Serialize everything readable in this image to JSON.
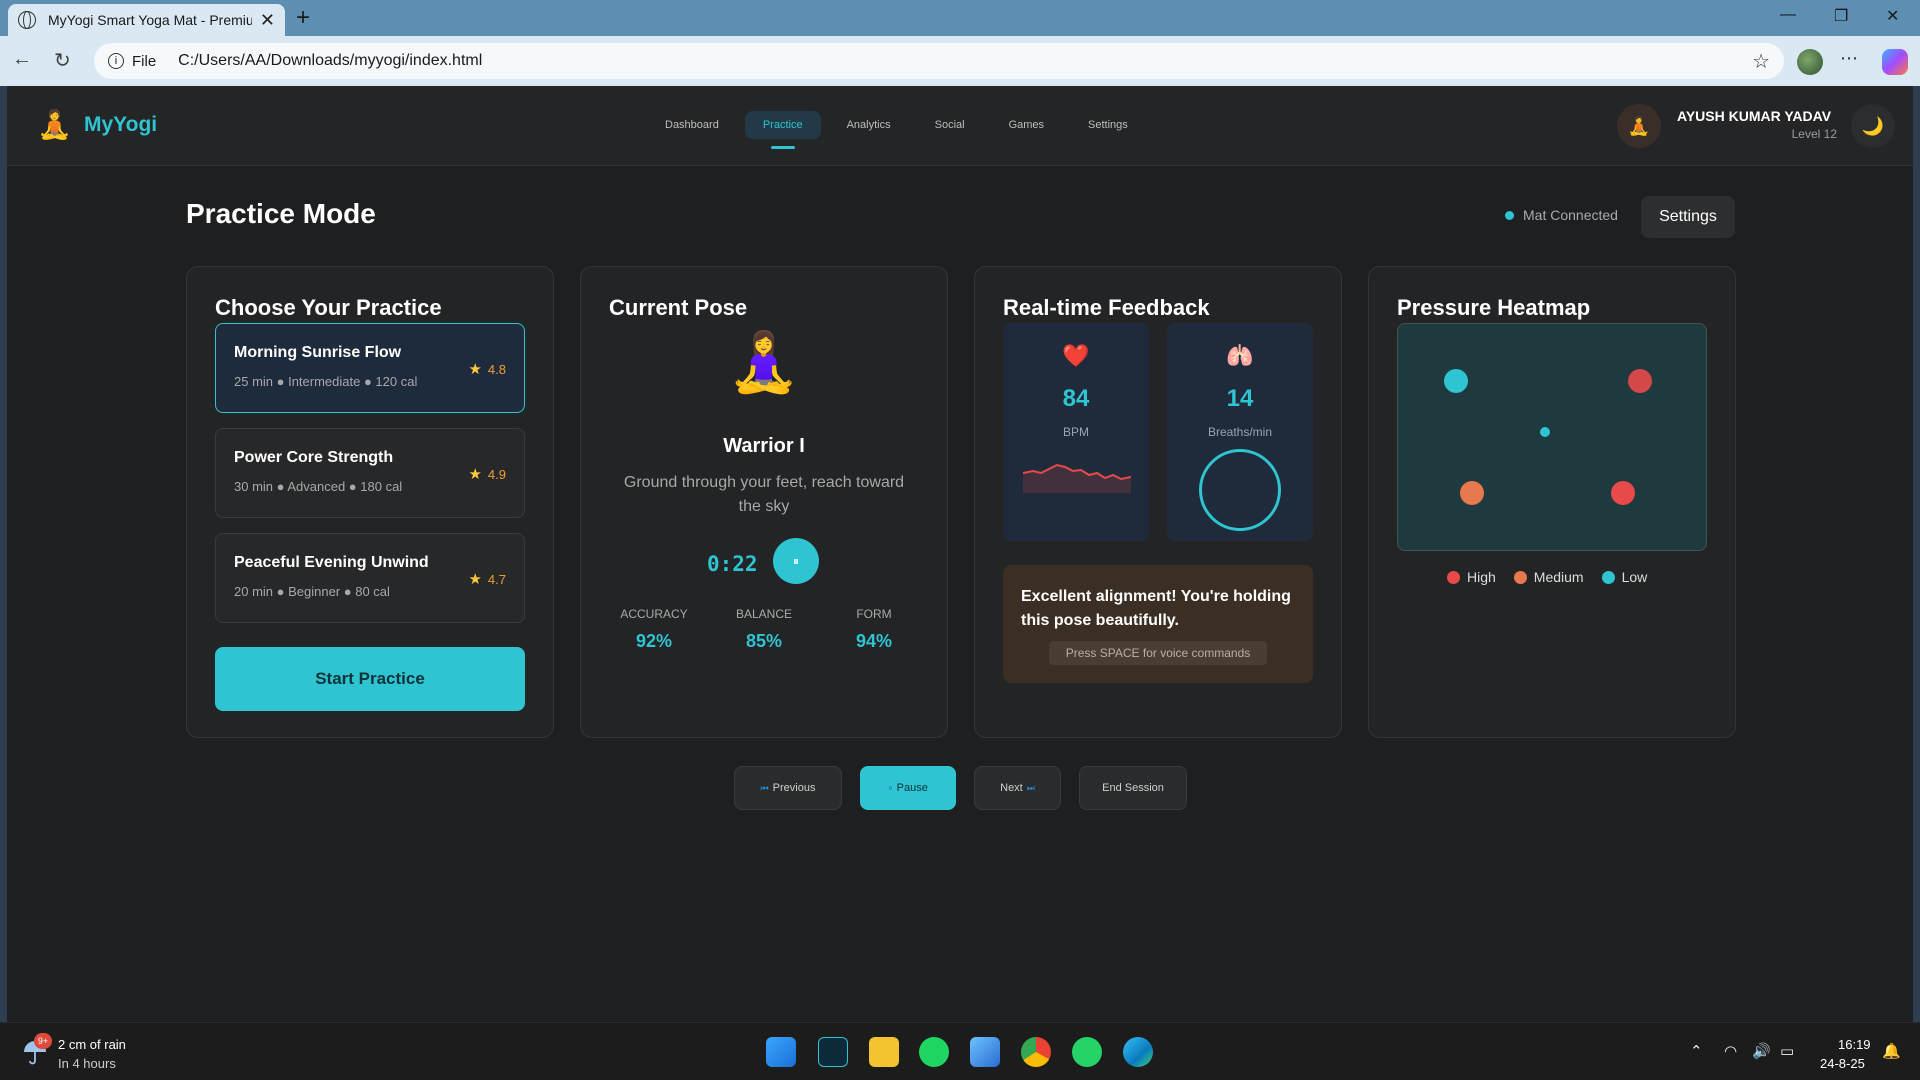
{
  "browser": {
    "tab_title": "MyYogi Smart Yoga Mat - Premiu",
    "new_tab": "+",
    "url_scheme_label": "File",
    "url": "C:/Users/AA/Downloads/myyogi/index.html"
  },
  "app": {
    "logo_icon": "🧘",
    "brand": "MyYogi",
    "nav": [
      {
        "label": "Dashboard"
      },
      {
        "label": "Practice"
      },
      {
        "label": "Analytics"
      },
      {
        "label": "Social"
      },
      {
        "label": "Games"
      },
      {
        "label": "Settings"
      }
    ],
    "active_nav": "Practice",
    "user": {
      "avatar": "🧘",
      "name": "AYUSH KUMAR YADAV",
      "level": "Level 12"
    },
    "theme_icon": "🌙"
  },
  "page": {
    "title": "Practice Mode",
    "mat_status": "Mat Connected",
    "settings_label": "Settings"
  },
  "choose_practice": {
    "title": "Choose Your Practice",
    "items": [
      {
        "name": "Morning Sunrise Flow",
        "meta": "25 min ● Intermediate ● 120 cal",
        "rating": "4.8",
        "selected": true
      },
      {
        "name": "Power Core Strength",
        "meta": "30 min ● Advanced ● 180 cal",
        "rating": "4.9",
        "selected": false
      },
      {
        "name": "Peaceful Evening Unwind",
        "meta": "20 min ● Beginner ● 80 cal",
        "rating": "4.7",
        "selected": false
      }
    ],
    "start_label": "Start Practice"
  },
  "current_pose": {
    "title": "Current Pose",
    "emoji": "🧘‍♀️",
    "name": "Warrior I",
    "description": "Ground through your feet, reach toward the sky",
    "timer": "0:22",
    "timer_button_icon": "⏸",
    "metrics": [
      {
        "label": "ACCURACY",
        "value": "92%"
      },
      {
        "label": "BALANCE",
        "value": "85%"
      },
      {
        "label": "FORM",
        "value": "94%"
      }
    ]
  },
  "feedback": {
    "title": "Real-time Feedback",
    "heart": {
      "icon": "❤️",
      "value": "84",
      "unit": "BPM"
    },
    "breath": {
      "icon": "🫁",
      "value": "14",
      "unit": "Breaths/min"
    },
    "message": "Excellent alignment! You're holding this pose beautifully.",
    "hint": "Press SPACE for voice commands"
  },
  "heatmap": {
    "title": "Pressure Heatmap",
    "legend": [
      {
        "label": "High",
        "color": "#e84a4a"
      },
      {
        "label": "Medium",
        "color": "#e8784e"
      },
      {
        "label": "Low",
        "color": "#2ec4d1"
      }
    ]
  },
  "controls": {
    "previous": "Previous",
    "pause": "Pause",
    "next": "Next",
    "end": "End Session",
    "previous_icon": "⏮",
    "pause_icon": "⏸",
    "next_icon": "⏭"
  },
  "taskbar": {
    "weather_badge": "9+",
    "weather_line1": "2 cm of rain",
    "weather_line2": "In 4 hours",
    "time": "16:19",
    "date": "24-8-25"
  },
  "colors": {
    "accent": "#2ec4d1",
    "high": "#e84a4a",
    "medium": "#e8784e",
    "low": "#2ec4d1"
  }
}
